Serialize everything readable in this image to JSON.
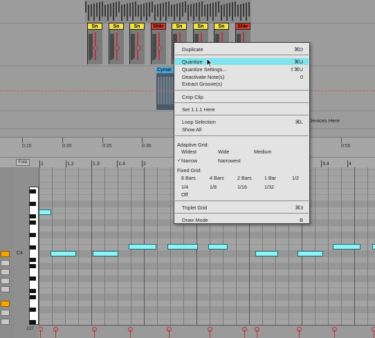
{
  "arrangement": {
    "clip_labels": [
      "Sn",
      "Sn",
      "Sn",
      "Shkr",
      "Sn",
      "Sn",
      "Sn",
      "Shkr"
    ],
    "clip_colors": [
      "yellow",
      "yellow",
      "yellow",
      "red",
      "yellow",
      "yellow",
      "yellow",
      "red"
    ],
    "audio_clip_label": "Cymat",
    "devices_hint": "Devices Here",
    "accent_colors": {
      "clip_yellow": "#f2e14a",
      "clip_red": "#e23a2a",
      "envelope": "#c0323b",
      "audio_clip": "#4aa5d6"
    }
  },
  "time_ruler": {
    "labels": [
      "0:15",
      "0:20",
      "0:25",
      "0:30",
      "0:55"
    ]
  },
  "piano_roll": {
    "fold_label": "Fold",
    "bar_labels": [
      "1",
      "1.2",
      "1.3",
      "1.4",
      "2",
      "3.4",
      "4"
    ],
    "pitch_label": "C4",
    "velocity_max_label": "127",
    "note_color": "#8ff2f4"
  },
  "menu": {
    "items": [
      {
        "label": "Duplicate",
        "shortcut": "⌘D"
      },
      {
        "label": "Quantize",
        "shortcut": "⌘U"
      },
      {
        "label": "Quantize Settings...",
        "shortcut": "⇧⌘U"
      },
      {
        "label": "Deactivate Note(s)",
        "shortcut": "0"
      },
      {
        "label": "Extract Groove(s)",
        "shortcut": ""
      },
      {
        "label": "Crop Clip",
        "shortcut": ""
      },
      {
        "label": "Set 1.1.1 Here",
        "shortcut": ""
      },
      {
        "label": "Loop Selection",
        "shortcut": "⌘L"
      },
      {
        "label": "Show All",
        "shortcut": ""
      }
    ],
    "highlighted_item": "Quantize",
    "adaptive_grid": {
      "title": "Adaptive Grid:",
      "options": [
        "Widest",
        "Wide",
        "Medium",
        "Narrow",
        "Narrowest"
      ],
      "checked": "Narrow"
    },
    "fixed_grid": {
      "title": "Fixed Grid:",
      "options": [
        "8 Bars",
        "4 Bars",
        "2 Bars",
        "1 Bar",
        "1/2",
        "1/4",
        "1/8",
        "1/16",
        "1/32",
        "Off"
      ]
    },
    "triplet": {
      "label": "Triplet Grid",
      "shortcut": "⌘3"
    },
    "draw_mode": {
      "label": "Draw Mode",
      "shortcut": "B"
    },
    "check_mark": "✓",
    "highlight_color": "#7ee3ea"
  }
}
